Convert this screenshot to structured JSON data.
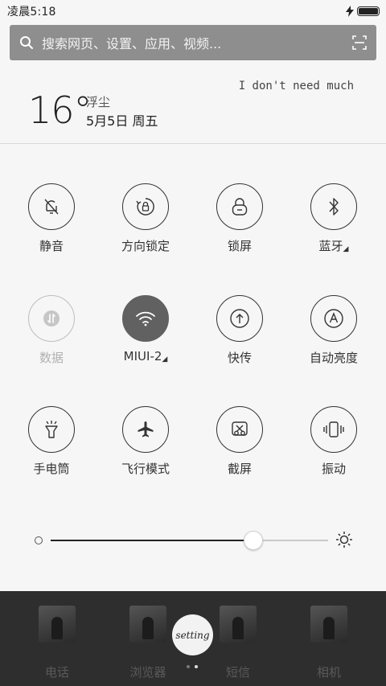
{
  "status_bar": {
    "time": "凌晨5:18"
  },
  "search": {
    "placeholder": "搜索网页、设置、应用、视频..."
  },
  "weather": {
    "temperature": "16°",
    "condition": "浮尘",
    "date": "5月5日 周五",
    "quote": "I don't need much"
  },
  "toggles": [
    {
      "id": "mute",
      "label": "静音",
      "icon": "bell-off-icon",
      "state": "off"
    },
    {
      "id": "rotation-lock",
      "label": "方向锁定",
      "icon": "rotation-lock-icon",
      "state": "off"
    },
    {
      "id": "lock-screen",
      "label": "锁屏",
      "icon": "lock-icon",
      "state": "off"
    },
    {
      "id": "bluetooth",
      "label": "蓝牙",
      "icon": "bluetooth-icon",
      "state": "off",
      "expandable": true
    },
    {
      "id": "data",
      "label": "数据",
      "icon": "data-arrows-icon",
      "state": "disabled"
    },
    {
      "id": "wifi",
      "label": "MIUI-2",
      "icon": "wifi-icon",
      "state": "on",
      "expandable": true
    },
    {
      "id": "quick-share",
      "label": "快传",
      "icon": "upload-icon",
      "state": "off"
    },
    {
      "id": "auto-brightness",
      "label": "自动亮度",
      "icon": "auto-brightness-icon",
      "state": "off"
    },
    {
      "id": "flashlight",
      "label": "手电筒",
      "icon": "flashlight-icon",
      "state": "off"
    },
    {
      "id": "airplane",
      "label": "飞行模式",
      "icon": "airplane-icon",
      "state": "off"
    },
    {
      "id": "screenshot",
      "label": "截屏",
      "icon": "scissors-icon",
      "state": "off"
    },
    {
      "id": "vibrate",
      "label": "振动",
      "icon": "vibrate-icon",
      "state": "off"
    }
  ],
  "brightness": {
    "level": 0.73
  },
  "dock": {
    "apps": [
      {
        "label": "电话"
      },
      {
        "label": "浏览器"
      },
      {
        "label": "短信"
      },
      {
        "label": "相机"
      }
    ],
    "setting_badge": "setting"
  },
  "colors": {
    "active_toggle": "#616161",
    "dock_bg": "#2e2e2e",
    "search_bg": "#8e8e8e"
  }
}
